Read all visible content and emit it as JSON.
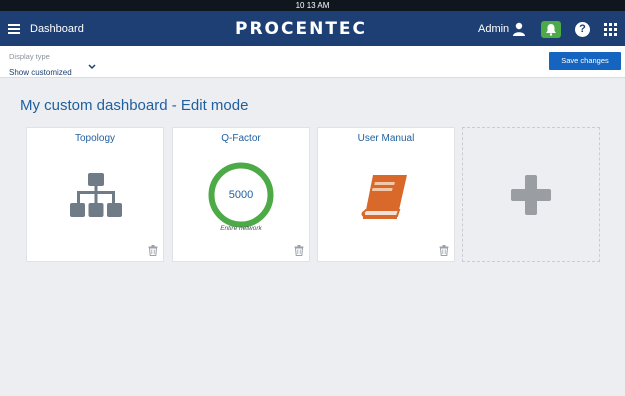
{
  "status_bar": {
    "time": "10 13 AM"
  },
  "header": {
    "nav_title": "Dashboard",
    "logo": "PROCENTEC",
    "user": "Admin",
    "icons": [
      "menu-icon",
      "user-icon",
      "bell-icon",
      "help-icon",
      "apps-grid-icon"
    ]
  },
  "toolbar": {
    "display_type_label": "Display type",
    "display_type_value": "Show customized",
    "save_label": "Save changes"
  },
  "main": {
    "title": "My custom dashboard - Edit mode",
    "cards": [
      {
        "title": "Topology",
        "icon": "network-topology-icon"
      },
      {
        "title": "Q-Factor",
        "value": "5000",
        "subtitle": "Entire network",
        "icon": "q-factor-ring"
      },
      {
        "title": "User Manual",
        "icon": "book-icon"
      }
    ],
    "add_card_icon": "plus-icon"
  },
  "colors": {
    "header_bg": "#1e3f73",
    "accent_blue": "#1f5f9f",
    "save_button": "#1565c0",
    "notification_green": "#4caa47",
    "qfactor_ring": "#4caa47",
    "book_orange": "#d9692b",
    "topology_gray": "#6f7b86"
  }
}
